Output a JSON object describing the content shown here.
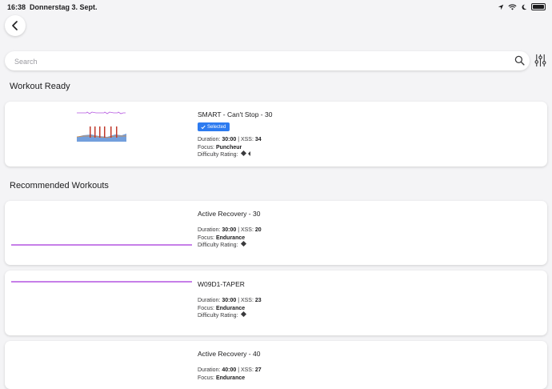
{
  "status_bar": {
    "time": "16:38",
    "date": "Donnerstag 3. Sept."
  },
  "search": {
    "placeholder": "Search"
  },
  "sections": {
    "ready_title": "Workout Ready",
    "recommended_title": "Recommended Workouts"
  },
  "workout_ready": {
    "title": "SMART - Can't Stop - 30",
    "badge": "Selected",
    "duration_label": "Duration: ",
    "duration": "30:00",
    "xss_label": " | XSS: ",
    "xss": "34",
    "focus_label": "Focus: ",
    "focus": "Puncheur",
    "difficulty_label": "Difficulty Rating: ",
    "difficulty_rating": 1.5
  },
  "recommended": [
    {
      "title": "Active Recovery - 30",
      "duration_label": "Duration: ",
      "duration": "30:00",
      "xss_label": " | XSS: ",
      "xss": "20",
      "focus_label": "Focus: ",
      "focus": "Endurance",
      "difficulty_label": "Difficulty Rating: ",
      "difficulty_rating": 1
    },
    {
      "title": "W09D1-TAPER",
      "duration_label": "Duration: ",
      "duration": "30:00",
      "xss_label": " | XSS: ",
      "xss": "23",
      "focus_label": "Focus: ",
      "focus": "Endurance",
      "difficulty_label": "Difficulty Rating: ",
      "difficulty_rating": 1
    },
    {
      "title": "Active Recovery - 40",
      "duration_label": "Duration: ",
      "duration": "40:00",
      "xss_label": " | XSS: ",
      "xss": "27",
      "focus_label": "Focus: ",
      "focus": "Endurance"
    }
  ],
  "colors": {
    "accent": "#2d7bf0",
    "profile_line": "#b455e0",
    "interval_bar": "#c0392b",
    "area_fill": "#5b8ed6"
  }
}
